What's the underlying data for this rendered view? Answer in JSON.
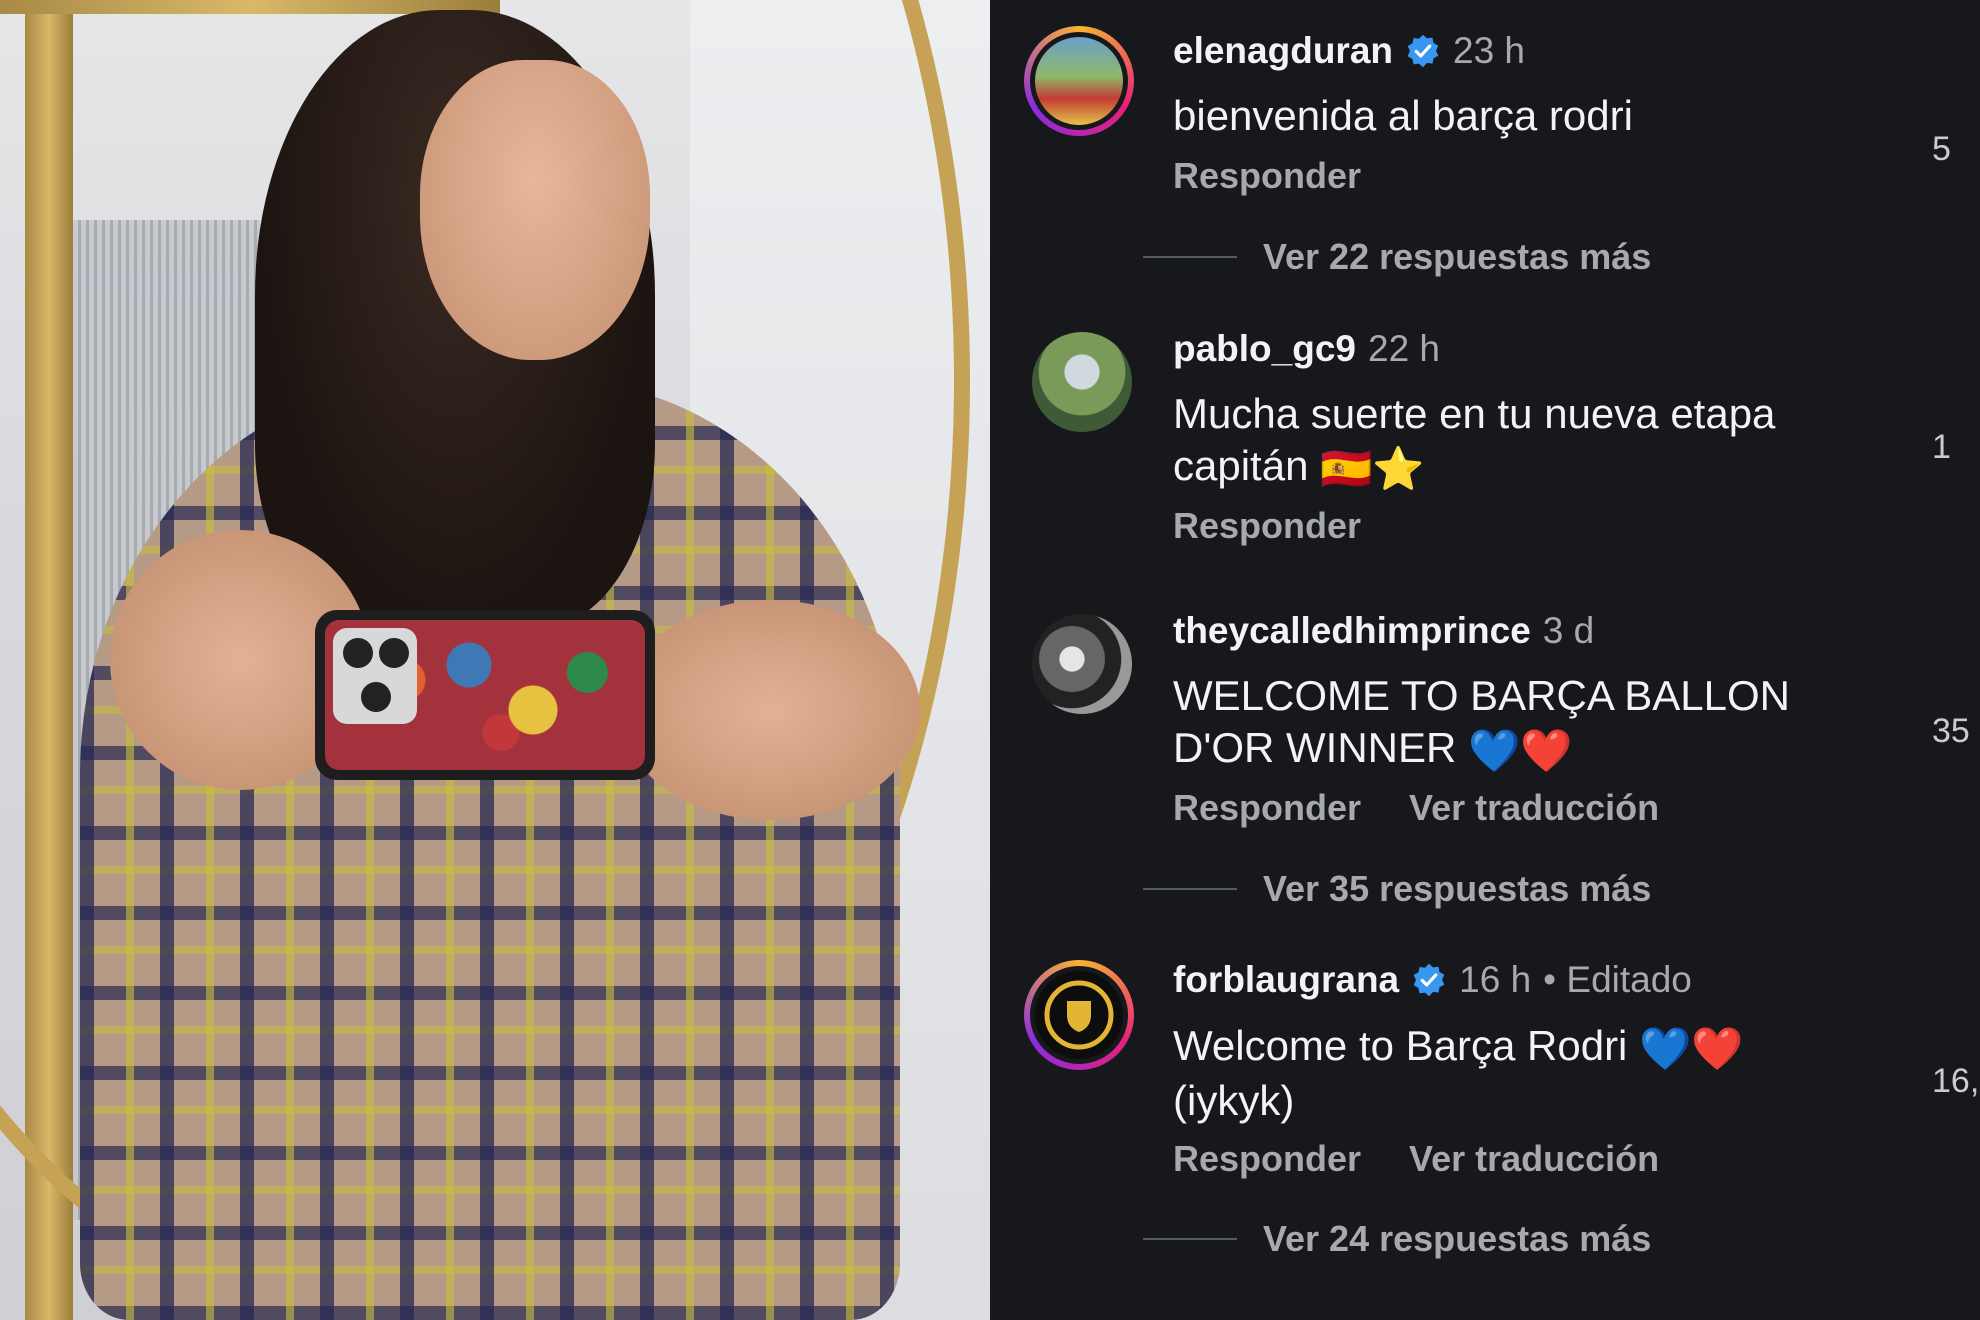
{
  "comments": [
    {
      "username": "elenagduran",
      "verified": true,
      "time": "23 h",
      "edited": "",
      "text": "bienvenida al barça rodri",
      "reply_label": "Responder",
      "translate_label": "",
      "more_replies": "Ver 22 respuestas más",
      "likes": "5"
    },
    {
      "username": "pablo_gc9",
      "verified": false,
      "time": "22 h",
      "edited": "",
      "text_line1": "Mucha suerte en tu nueva etapa",
      "text_line2": "capitán",
      "text_emoji": "🇪🇸⭐",
      "reply_label": "Responder",
      "translate_label": "",
      "more_replies": "",
      "likes": "1"
    },
    {
      "username": "theycalledhimprince",
      "verified": false,
      "time": "3 d",
      "edited": "",
      "text_line1": "WELCOME TO BARÇA BALLON",
      "text_line2": "D'OR WINNER",
      "text_emoji": "💙❤️",
      "reply_label": "Responder",
      "translate_label": "Ver traducción",
      "more_replies": "Ver 35 respuestas más",
      "likes": "35"
    },
    {
      "username": "forblaugrana",
      "verified": true,
      "time": "16 h",
      "edited": "• Editado",
      "text_line1": "Welcome to Barça Rodri",
      "text_line1_emoji": "💙❤️",
      "text_line2": "(iykyk)",
      "reply_label": "Responder",
      "translate_label": "Ver traducción",
      "more_replies": "Ver 24 respuestas más",
      "likes": "16,"
    }
  ],
  "icons": {
    "verified": "verified-badge-icon"
  },
  "colors": {
    "background": "#16181c",
    "text_primary": "#f2f3f5",
    "text_secondary": "#a7a9ad",
    "verified_blue": "#3897f0"
  }
}
